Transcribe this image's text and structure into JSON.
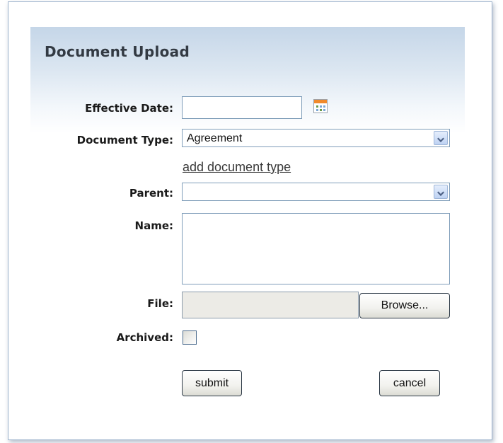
{
  "form": {
    "title": "Document Upload",
    "effective_date": {
      "label": "Effective Date:",
      "value": ""
    },
    "document_type": {
      "label": "Document Type:",
      "selected": "Agreement"
    },
    "add_document_type_link": "add document type",
    "parent": {
      "label": "Parent:",
      "selected": ""
    },
    "name": {
      "label": "Name:",
      "value": ""
    },
    "file": {
      "label": "File:",
      "value": "",
      "browse_label": "Browse..."
    },
    "archived": {
      "label": "Archived:",
      "checked": false
    },
    "submit_label": "submit",
    "cancel_label": "cancel"
  },
  "icons": {
    "calendar": "calendar-icon",
    "dropdown": "chevron-down-icon"
  },
  "colors": {
    "header_gradient_top": "#c5d6e8",
    "input_border": "#7f9db9",
    "calendar_accent": "#f08a2c"
  }
}
